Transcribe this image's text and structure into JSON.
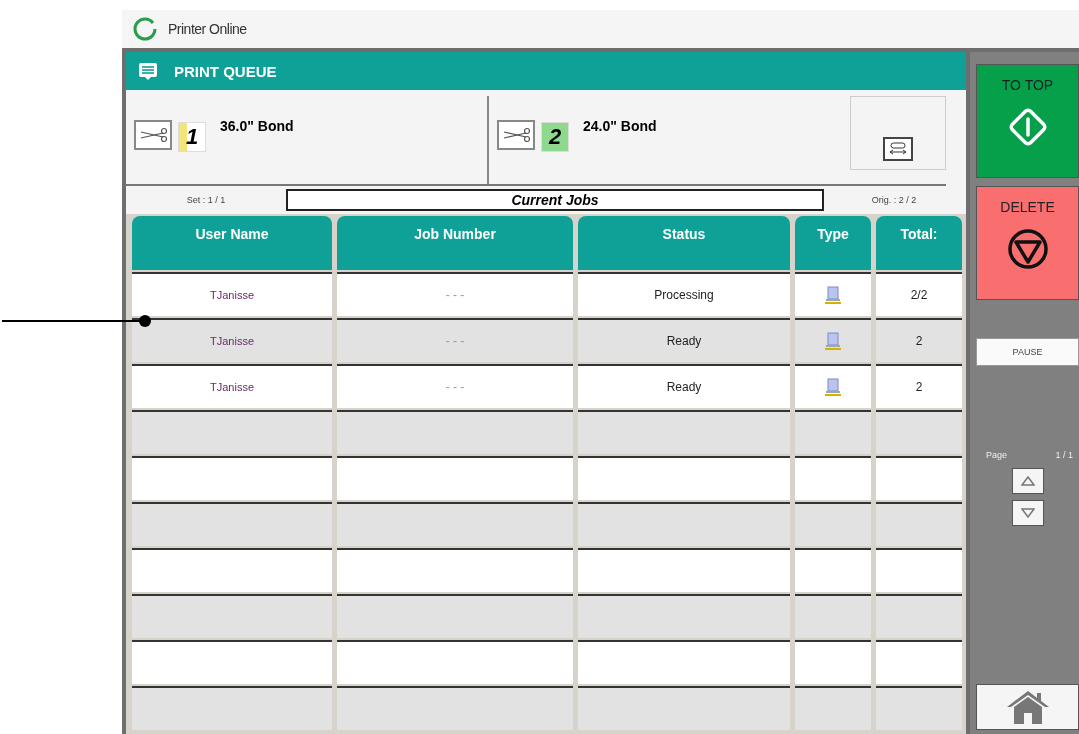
{
  "status_bar": {
    "text": "Printer Online"
  },
  "header": {
    "title": "PRINT QUEUE"
  },
  "rolls": [
    {
      "number": "1",
      "media": "36.0\" Bond",
      "color": "#f3e47a"
    },
    {
      "number": "2",
      "media": "24.0\" Bond",
      "color": "#8ed98e"
    }
  ],
  "set_label": "Set : 1 / 1",
  "list_title": "Current Jobs",
  "orig_label": "Orig. : 2 / 2",
  "table": {
    "columns": [
      "User Name",
      "Job Number",
      "Status",
      "Type",
      "Total:"
    ],
    "rows": [
      {
        "user": "TJanisse",
        "job": "- - -",
        "status": "Processing",
        "total": "2/2"
      },
      {
        "user": "TJanisse",
        "job": "- - -",
        "status": "Ready",
        "total": "2"
      },
      {
        "user": "TJanisse",
        "job": "- - -",
        "status": "Ready",
        "total": "2"
      }
    ]
  },
  "side_buttons": [
    {
      "label": "TO TOP",
      "kind": "start"
    },
    {
      "label": "DELETE",
      "kind": "stop"
    }
  ],
  "pause_label": "PAUSE",
  "page_label": "Page",
  "page_count": "1 / 1"
}
